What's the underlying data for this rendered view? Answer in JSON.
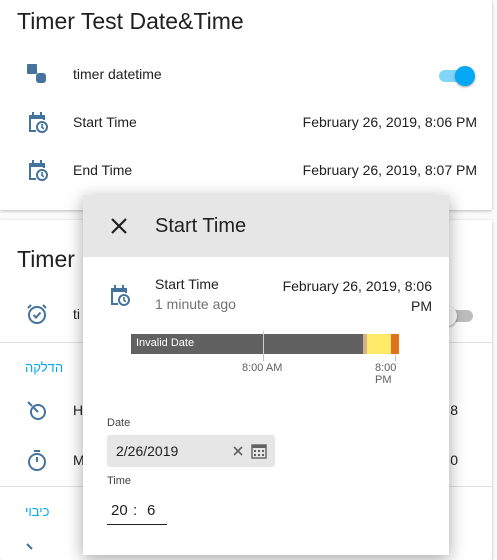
{
  "card1": {
    "title": "Timer Test Date&Time",
    "rows": [
      {
        "icon": "entity-icon",
        "label": "timer datetime"
      },
      {
        "icon": "calendar-clock-icon",
        "label": "Start Time",
        "value": "February 26, 2019, 8:06 PM"
      },
      {
        "icon": "calendar-clock-icon",
        "label": "End Time",
        "value": "February 26, 2019, 8:07 PM"
      }
    ],
    "toggle": {
      "state": "on",
      "color": "#03a9f4"
    }
  },
  "card2": {
    "title": "Timer",
    "row1": {
      "label": "ti"
    },
    "section1": "הדלקה",
    "row2": {
      "label": "H",
      "value": "8"
    },
    "row3": {
      "label": "M",
      "value": "0"
    },
    "section2": "כיבוי"
  },
  "dialog": {
    "title": "Start Time",
    "entity": {
      "name": "Start Time",
      "relative": "1 minute ago",
      "value": "February 26, 2019, 8:06 PM"
    },
    "timeline": {
      "bar_label": "Invalid Date",
      "ticks": [
        "8:00 AM",
        "8:00 PM"
      ],
      "colors": {
        "main": "#616161",
        "tan": "#d2b48c",
        "yellow": "#ffeb67",
        "orange": "#e2711d"
      }
    },
    "date": {
      "label": "Date",
      "value": "2/26/2019"
    },
    "time": {
      "label": "Time",
      "hours": "20",
      "separator": ":",
      "minutes": "6"
    }
  }
}
